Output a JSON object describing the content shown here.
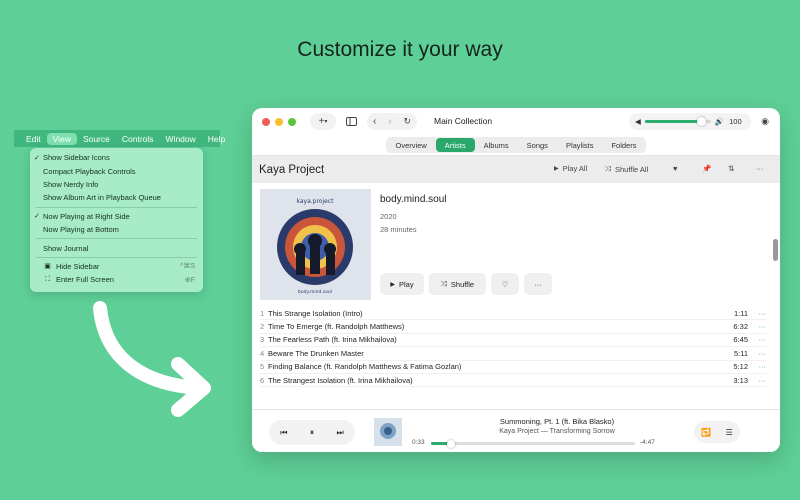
{
  "headline": "Customize it your way",
  "menubar": {
    "items": [
      "Edit",
      "View",
      "Source",
      "Controls",
      "Window",
      "Help"
    ],
    "active": "View"
  },
  "view_menu": {
    "items": [
      {
        "label": "Show Sidebar Icons",
        "checked": true
      },
      {
        "label": "Compact Playback Controls"
      },
      {
        "label": "Show Nerdy Info"
      },
      {
        "label": "Show Album Art in Playback Queue"
      },
      {
        "label": "Now Playing at Right Side",
        "checked": true
      },
      {
        "label": "Now Playing at Bottom"
      },
      {
        "label": "Show Journal"
      },
      {
        "label": "Hide Sidebar",
        "shortcut": "^⌘S"
      },
      {
        "label": "Enter Full Screen",
        "shortcut": "⊕F"
      }
    ]
  },
  "window": {
    "title": "Main Collection",
    "volume": {
      "value": "100",
      "level": 0.85
    },
    "tabs": [
      "Overview",
      "Artists",
      "Albums",
      "Songs",
      "Playlists",
      "Folders"
    ],
    "selected_tab": "Artists",
    "artist": {
      "name": "Kaya Project",
      "play_all": "Play All",
      "shuffle_all": "Shuffle All"
    },
    "album": {
      "title": "body.mind.soul",
      "year": "2020",
      "duration": "28 minutes",
      "cover_text_top": "kaya.project",
      "cover_text_bottom": "body.mind.soul",
      "play": "Play",
      "shuffle": "Shuffle",
      "more": "···"
    },
    "tracks": [
      {
        "num": "1",
        "title": "This Strange Isolation (Intro)",
        "duration": "1:11"
      },
      {
        "num": "2",
        "title": "Time To Emerge (ft. Randolph Matthews)",
        "duration": "6:32"
      },
      {
        "num": "3",
        "title": "The Fearless Path (ft. Irina Mikhailova)",
        "duration": "6:45"
      },
      {
        "num": "4",
        "title": "Beware The Drunken Master",
        "duration": "5:11"
      },
      {
        "num": "5",
        "title": "Finding Balance (ft. Randolph Matthews & Fatima Gozlan)",
        "duration": "5:12"
      },
      {
        "num": "6",
        "title": "The Strangest Isolation (ft. Irina Mikhailova)",
        "duration": "3:13"
      }
    ],
    "track_more": "···",
    "now_playing": {
      "title": "Summoning, Pt. 1 (ft. Bika Blasko)",
      "subtitle": "Kaya Project — Transforming Sorrow",
      "elapsed": "0:33",
      "remaining": "-4:47",
      "progress": 0.1
    }
  },
  "colors": {
    "background": "#5ecf96",
    "accent": "#2aad6e",
    "menu": "#a7ebc7"
  }
}
